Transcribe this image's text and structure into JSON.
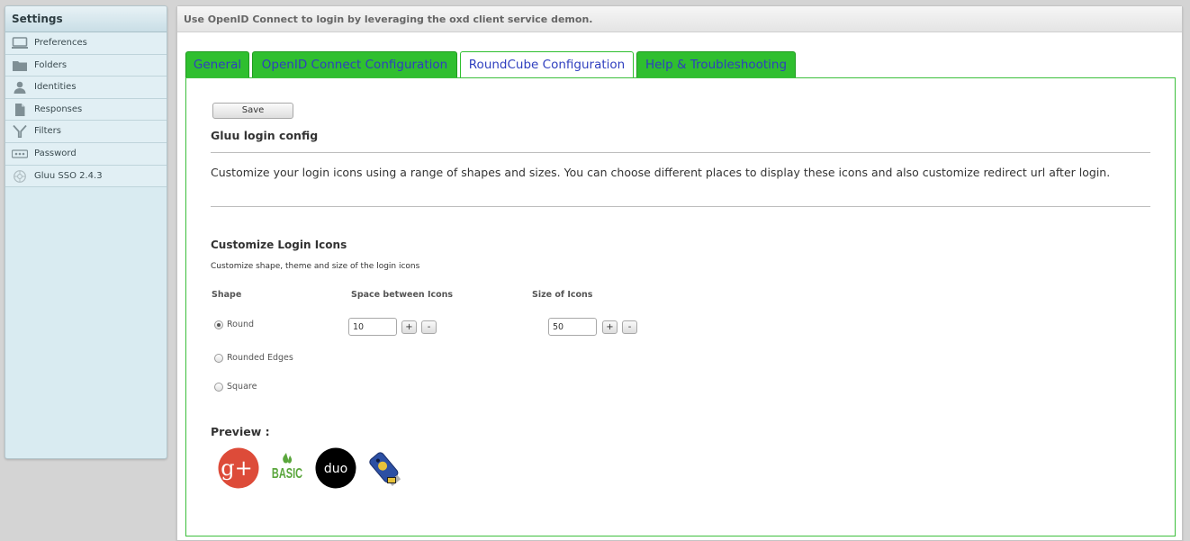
{
  "sidebar": {
    "title": "Settings",
    "items": [
      {
        "label": "Preferences",
        "icon": "monitor-icon"
      },
      {
        "label": "Folders",
        "icon": "folder-icon"
      },
      {
        "label": "Identities",
        "icon": "person-icon"
      },
      {
        "label": "Responses",
        "icon": "document-icon"
      },
      {
        "label": "Filters",
        "icon": "filter-icon"
      },
      {
        "label": "Password",
        "icon": "password-icon"
      },
      {
        "label": "Gluu SSO 2.4.3",
        "icon": "gluu-icon"
      }
    ]
  },
  "header": {
    "description": "Use OpenID Connect to login by leveraging the oxd client service demon."
  },
  "tabs": [
    {
      "label": "General",
      "active": false
    },
    {
      "label": "OpenID Connect Configuration",
      "active": false
    },
    {
      "label": "RoundCube Configuration",
      "active": true
    },
    {
      "label": "Help & Troubleshooting",
      "active": false
    }
  ],
  "content": {
    "save_label": "Save",
    "config_heading": "Gluu login config",
    "config_description": "Customize your login icons using a range of shapes and sizes. You can choose different places to display these icons and also customize redirect url after login.",
    "icons_heading": "Customize Login Icons",
    "icons_subheading": "Customize shape, theme and size of the login icons",
    "columns": {
      "shape": "Shape",
      "space": "Space between Icons",
      "size": "Size of Icons"
    },
    "shapes": [
      {
        "label": "Round",
        "checked": true
      },
      {
        "label": "Rounded Edges",
        "checked": false
      },
      {
        "label": "Square",
        "checked": false
      }
    ],
    "space_value": "10",
    "size_value": "50",
    "plus_label": "+",
    "minus_label": "-",
    "preview_label": "Preview :",
    "preview_icons": [
      {
        "name": "google-plus-icon",
        "text": "g+",
        "color": "#dd4b39"
      },
      {
        "name": "basic-icon",
        "text": "BASIC",
        "color": "#5aa63c"
      },
      {
        "name": "duo-icon",
        "text": "duo",
        "color": "#000000"
      },
      {
        "name": "u2f-key-icon",
        "text": "",
        "color": "#2c4fa3"
      }
    ]
  },
  "colors": {
    "tab_green": "#2fbf2f",
    "tab_text": "#2f3fbf",
    "content_border": "#3cbf3c",
    "sidebar_bg": "#d9ebf1"
  }
}
